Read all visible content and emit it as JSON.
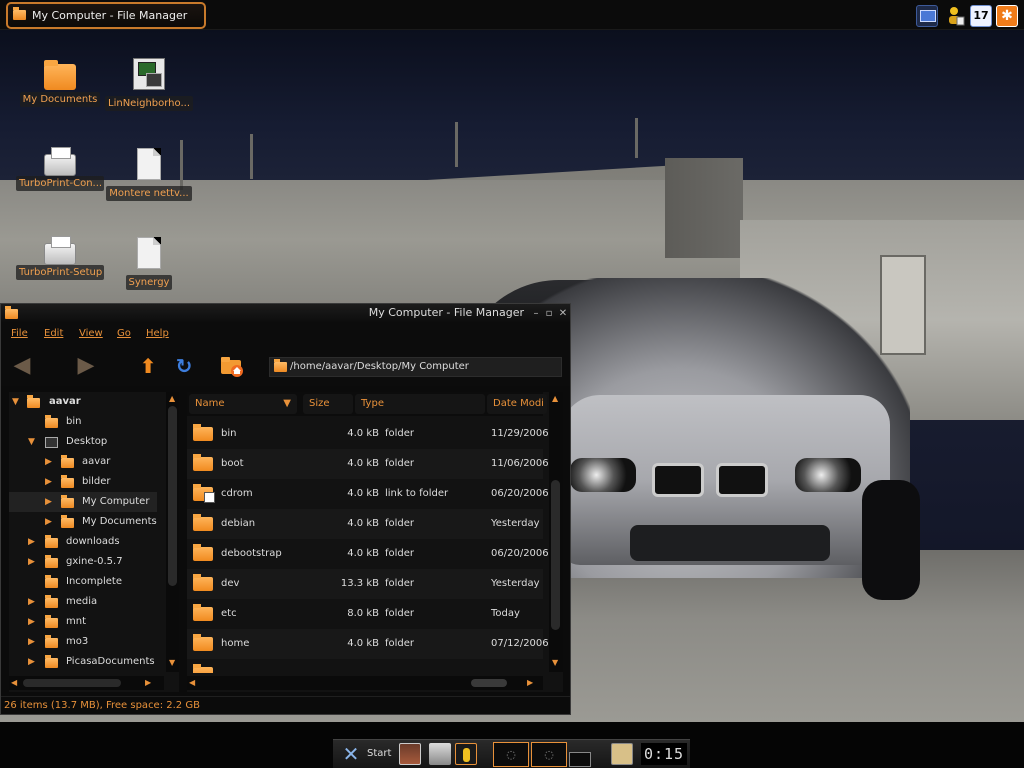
{
  "top_panel": {
    "task_title": "My Computer - File Manager",
    "tray": {
      "calendar_day": "17",
      "icons": [
        "monitor-icon",
        "user-icon",
        "calendar-icon",
        "star-icon"
      ]
    }
  },
  "desktop": {
    "icons": [
      {
        "label": "My Documents",
        "icon": "folder-icon"
      },
      {
        "label": "LinNeighborho...",
        "icon": "network-icon"
      },
      {
        "label": "TurboPrint-Con...",
        "icon": "printer-icon"
      },
      {
        "label": "Montere nettv...",
        "icon": "document-icon"
      },
      {
        "label": "TurboPrint-Setup",
        "icon": "printer-icon"
      },
      {
        "label": "Synergy",
        "icon": "document-icon"
      }
    ]
  },
  "file_manager": {
    "title": "My Computer - File Manager",
    "menu": [
      "File",
      "Edit",
      "View",
      "Go",
      "Help"
    ],
    "location": "/home/aavar/Desktop/My Computer",
    "tree": [
      {
        "label": "aavar",
        "depth": 0,
        "expander": "▼",
        "bold": true
      },
      {
        "label": "bin",
        "depth": 1,
        "expander": ""
      },
      {
        "label": "Desktop",
        "depth": 1,
        "expander": "▼"
      },
      {
        "label": "aavar",
        "depth": 2,
        "expander": "▶"
      },
      {
        "label": "bilder",
        "depth": 2,
        "expander": "▶"
      },
      {
        "label": "My Computer",
        "depth": 2,
        "expander": "▶",
        "selected": true
      },
      {
        "label": "My Documents",
        "depth": 2,
        "expander": "▶"
      },
      {
        "label": "downloads",
        "depth": 1,
        "expander": "▶"
      },
      {
        "label": "gxine-0.5.7",
        "depth": 1,
        "expander": "▶"
      },
      {
        "label": "Incomplete",
        "depth": 1,
        "expander": ""
      },
      {
        "label": "media",
        "depth": 1,
        "expander": "▶"
      },
      {
        "label": "mnt",
        "depth": 1,
        "expander": "▶"
      },
      {
        "label": "mo3",
        "depth": 1,
        "expander": "▶"
      },
      {
        "label": "PicasaDocuments",
        "depth": 1,
        "expander": "▶"
      }
    ],
    "columns": {
      "name": "Name",
      "size": "Size",
      "type": "Type",
      "date": "Date Modi"
    },
    "sort_indicator": "▼",
    "files": [
      {
        "name": "bin",
        "size": "4.0 kB",
        "type": "folder",
        "date": "11/29/2006"
      },
      {
        "name": "boot",
        "size": "4.0 kB",
        "type": "folder",
        "date": "11/06/2006"
      },
      {
        "name": "cdrom",
        "size": "4.0 kB",
        "type": "link to folder",
        "date": "06/20/2006",
        "link": true
      },
      {
        "name": "debian",
        "size": "4.0 kB",
        "type": "folder",
        "date": "Yesterday"
      },
      {
        "name": "debootstrap",
        "size": "4.0 kB",
        "type": "folder",
        "date": "06/20/2006"
      },
      {
        "name": "dev",
        "size": "13.3 kB",
        "type": "folder",
        "date": "Yesterday"
      },
      {
        "name": "etc",
        "size": "8.0 kB",
        "type": "folder",
        "date": "Today"
      },
      {
        "name": "home",
        "size": "4.0 kB",
        "type": "folder",
        "date": "07/12/2006"
      }
    ],
    "status": "26 items (13.7 MB), Free space: 2.2 GB"
  },
  "bottom_panel": {
    "start_label": "Start",
    "pager_1": "◌",
    "pager_2": "◌",
    "clock": "0:15"
  },
  "colors": {
    "accent": "#e8913a",
    "window_bg": "#0b0b0b",
    "task_border": "#c87a2b"
  }
}
